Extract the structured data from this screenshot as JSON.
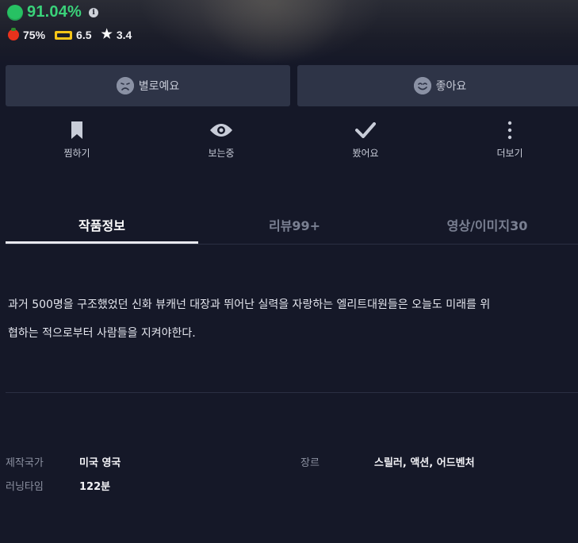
{
  "scores": {
    "match_percent": "91.04%",
    "tomato": "75%",
    "imdb": "6.5",
    "star": "3.4"
  },
  "vote": {
    "dislike_label": "별로예요",
    "like_label": "좋아요"
  },
  "actions": [
    {
      "label": "찜하기",
      "icon": "bookmark-icon"
    },
    {
      "label": "보는중",
      "icon": "eye-icon"
    },
    {
      "label": "봤어요",
      "icon": "check-icon"
    },
    {
      "label": "더보기",
      "icon": "more-vertical-icon"
    }
  ],
  "tabs": [
    {
      "label": "작품정보",
      "active": true
    },
    {
      "label": "리뷰99+",
      "active": false
    },
    {
      "label": "영상/이미지30",
      "active": false
    }
  ],
  "synopsis": {
    "line1": "과거 500명을 구조했었던 신화  뷰캐넌 대장과 뛰어난 실력을 자랑하는 엘리트대원들은 오늘도 미래를 위",
    "line2": "협하는 적으로부터 사람들을 지켜야한다."
  },
  "details": {
    "country_label": "제작국가",
    "country_value": "미국   영국",
    "genre_label": "장르",
    "genre_value": "스릴러, 액션, 어드벤처",
    "runtime_label": "러닝타임",
    "runtime_value": "122분"
  },
  "colors": {
    "background": "#151828",
    "match_green": "#3ad27a",
    "button_bg": "#2e3447",
    "tab_active": "#ffffff",
    "tab_inactive": "#7a8092"
  }
}
